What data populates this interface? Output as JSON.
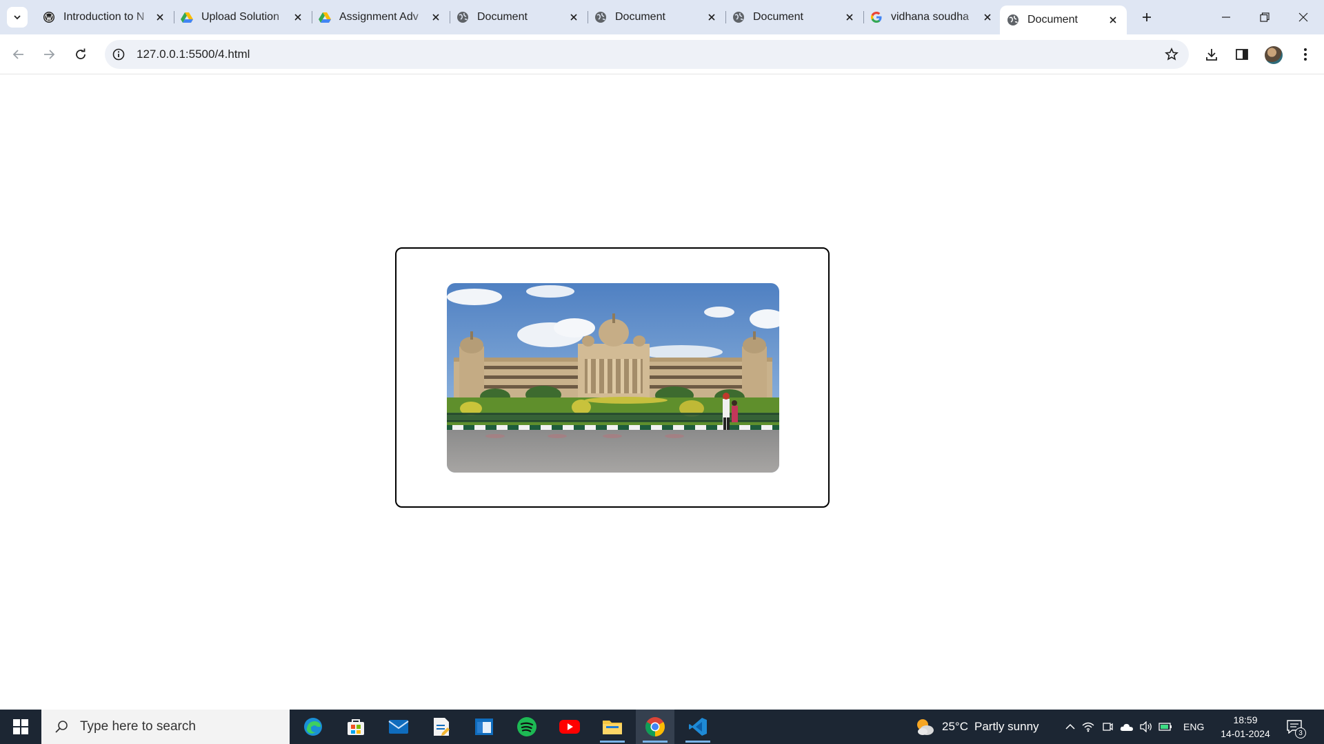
{
  "browser": {
    "tabs": [
      {
        "title": "Introduction to N",
        "favicon": "wordpress-icon"
      },
      {
        "title": "Upload Solution",
        "favicon": "google-drive-icon"
      },
      {
        "title": "Assignment Adv",
        "favicon": "google-drive-icon"
      },
      {
        "title": "Document",
        "favicon": "globe-icon"
      },
      {
        "title": "Document",
        "favicon": "globe-icon"
      },
      {
        "title": "Document",
        "favicon": "globe-icon"
      },
      {
        "title": "vidhana soudha",
        "favicon": "google-icon"
      },
      {
        "title": "Document",
        "favicon": "globe-icon",
        "active": true
      }
    ],
    "url": "127.0.0.1:5500/4.html"
  },
  "page": {
    "image_subject": "Vidhana Soudha building photo"
  },
  "taskbar": {
    "search_placeholder": "Type here to search",
    "apps": [
      "edge",
      "microsoft-store",
      "mail",
      "notepad-document",
      "app-window",
      "spotify",
      "youtube",
      "file-explorer",
      "chrome",
      "vscode"
    ],
    "weather": {
      "temp": "25°C",
      "condition": "Partly sunny"
    },
    "language": "ENG",
    "time": "18:59",
    "date": "14-01-2024",
    "notification_count": "3"
  },
  "colors": {
    "tabstrip": "#dfe6f3",
    "taskbar": "#1c2633",
    "omnibox": "#eef1f7"
  }
}
